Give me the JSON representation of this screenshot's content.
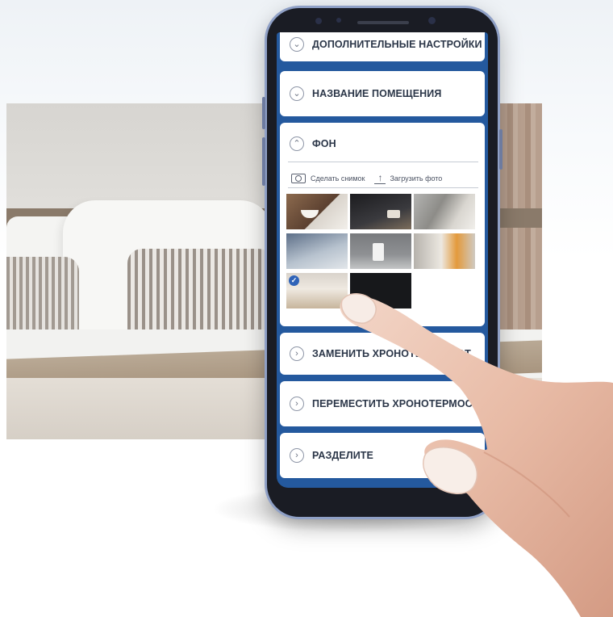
{
  "app": {
    "panels": [
      {
        "label": "ДОПОЛНИТЕЛЬНЫЕ НАСТРОЙКИ",
        "expanded": false,
        "chevron": "chevron-down-icon"
      },
      {
        "label": "НАЗВАНИЕ ПОМЕЩЕНИЯ",
        "expanded": false,
        "chevron": "chevron-down-icon"
      },
      {
        "label": "ФОН",
        "expanded": true,
        "chevron": "chevron-up-icon"
      },
      {
        "label": "ЗАМЕНИТЬ ХРОНОТЕРМОСТАТ",
        "expanded": false,
        "chevron": "chevron-right-icon"
      },
      {
        "label": "ПЕРЕМЕСТИТЬ ХРОНОТЕРМОСТАТ",
        "expanded": false,
        "chevron": "chevron-right-icon"
      },
      {
        "label": "РАЗДЕЛИТЕ",
        "expanded": false,
        "chevron": "chevron-right-icon"
      }
    ],
    "background_section": {
      "take_photo_label": "Сделать снимок",
      "upload_photo_label": "Загрузить фото",
      "thumbnails": [
        {
          "name": "bathroom-sink",
          "selected": false
        },
        {
          "name": "dark-kitchen",
          "selected": false
        },
        {
          "name": "grey-living-room",
          "selected": false
        },
        {
          "name": "blue-office",
          "selected": false
        },
        {
          "name": "grey-wall-thermostat",
          "selected": false
        },
        {
          "name": "bright-hallway",
          "selected": false
        },
        {
          "name": "bedroom",
          "selected": true
        },
        {
          "name": "black",
          "selected": false
        }
      ]
    },
    "colors": {
      "screen_background": "#24599e",
      "panel_background": "#ffffff",
      "label_text": "#2b3648",
      "selected_check": "#2f63b8"
    }
  },
  "icons": {
    "chevron_down": "⌄",
    "chevron_up": "⌃",
    "chevron_right": "›",
    "upload": "↑",
    "check": "✓"
  }
}
